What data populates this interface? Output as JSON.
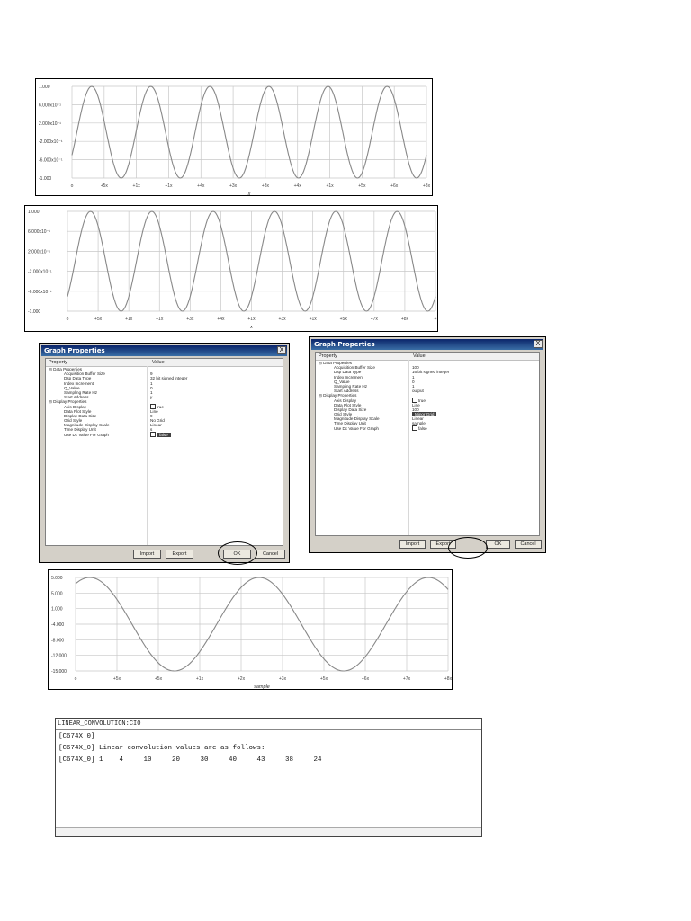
{
  "chart_data": [
    {
      "type": "line",
      "title": "",
      "xlabel": "x",
      "ylabel": "",
      "y_ticks": [
        "1.000",
        "6.000x10⁻¹",
        "2.000x10⁻¹",
        "-2.000x10⁻¹",
        "-6.000x10⁻¹",
        "-1.000"
      ],
      "x_ticks": [
        "o",
        "+5x",
        "+1x",
        "+1x",
        "+4x",
        "+3x",
        "+3x",
        "+4x",
        "+1x",
        "+5x",
        "+6x",
        "+8x"
      ],
      "ylim": [
        -1,
        1
      ],
      "xlim": [
        0,
        12
      ],
      "grid": true,
      "series": [
        {
          "x_start": 0,
          "x_end": 12,
          "cycles": 6,
          "amplitude": 1,
          "phase_deg": -30,
          "color": "#888888"
        }
      ]
    },
    {
      "type": "line",
      "title": "",
      "xlabel": "x",
      "ylabel": "",
      "y_ticks": [
        "1.000",
        "6.000x10⁻¹",
        "2.000x10⁻¹",
        "-2.000x10⁻¹",
        "-6.000x10⁻¹",
        "-1.000"
      ],
      "x_ticks": [
        "o",
        "+5x",
        "+1x",
        "+1x",
        "+3x",
        "+4x",
        "+1x",
        "+3x",
        "+1x",
        "+5x",
        "+7x",
        "+8x",
        "+"
      ],
      "ylim": [
        -1,
        1
      ],
      "xlim": [
        0,
        12
      ],
      "grid": true,
      "series": [
        {
          "x_start": 0,
          "x_end": 12,
          "cycles": 6,
          "amplitude": 1,
          "phase_deg": -45,
          "color": "#888888"
        }
      ]
    },
    {
      "type": "line",
      "title": "",
      "xlabel": "sample",
      "ylabel": "",
      "y_ticks": [
        "5.000",
        "5.000",
        "1.000",
        "-4.000",
        "-8.000",
        "-12.000",
        "-15.000"
      ],
      "x_ticks": [
        "o",
        "+5x",
        "+5x",
        "+1x",
        "+2x",
        "+3x",
        "+5x",
        "+6x",
        "+7x",
        "+8x"
      ],
      "ylim": [
        -1,
        1
      ],
      "xlim": [
        0,
        9
      ],
      "grid": true,
      "series": [
        {
          "x_start": 0,
          "x_end": 9,
          "cycles": 2.2,
          "amplitude": 1,
          "phase_deg": 60,
          "color": "#888888"
        }
      ]
    }
  ],
  "dialog_left": {
    "title": "Graph Properties",
    "close": "X",
    "header": {
      "property": "Property",
      "value": "Value"
    },
    "rows": [
      {
        "p": "⊟ Data Properties",
        "v": "",
        "indent": 0
      },
      {
        "p": "Acquisition Buffer Size",
        "v": "9",
        "indent": 1
      },
      {
        "p": "Dsp Data Type",
        "v": "32 bit signed integer",
        "indent": 1
      },
      {
        "p": "Index Increment",
        "v": "1",
        "indent": 1
      },
      {
        "p": "Q_Value",
        "v": "0",
        "indent": 1
      },
      {
        "p": "Sampling Rate Hz",
        "v": "1",
        "indent": 1
      },
      {
        "p": "Start Address",
        "v": "y",
        "indent": 1
      },
      {
        "p": "⊟ Display Properties",
        "v": "",
        "indent": 0
      },
      {
        "p": "Axis Display",
        "v": "true",
        "indent": 1,
        "check": true
      },
      {
        "p": "Data Plot Style",
        "v": "Line",
        "indent": 1
      },
      {
        "p": "Display Data Size",
        "v": "9",
        "indent": 1
      },
      {
        "p": "Grid Style",
        "v": "No Grid",
        "indent": 1
      },
      {
        "p": "Magnitude Display Scale",
        "v": "Linear",
        "indent": 1
      },
      {
        "p": "Time Display Unit",
        "v": "s",
        "indent": 1
      },
      {
        "p": "Use Dc Value For Graph",
        "v": "false",
        "indent": 1,
        "check": true,
        "selected": true
      }
    ],
    "buttons": {
      "import": "Import",
      "export": "Export",
      "ok": "OK",
      "cancel": "Cancel"
    }
  },
  "dialog_right": {
    "title": "Graph Properties",
    "close": "X",
    "header": {
      "property": "Property",
      "value": "Value"
    },
    "rows": [
      {
        "p": "⊟ Data Properties",
        "v": "",
        "indent": 0
      },
      {
        "p": "Acquisition Buffer Size",
        "v": "100",
        "indent": 1
      },
      {
        "p": "Dsp Data Type",
        "v": "16 bit signed integer",
        "indent": 1
      },
      {
        "p": "Index Increment",
        "v": "1",
        "indent": 1
      },
      {
        "p": "Q_Value",
        "v": "0",
        "indent": 1
      },
      {
        "p": "Sampling Rate Hz",
        "v": "1",
        "indent": 1
      },
      {
        "p": "Start Address",
        "v": "output",
        "indent": 1
      },
      {
        "p": "⊟ Display Properties",
        "v": "",
        "indent": 0
      },
      {
        "p": "Axis Display",
        "v": "true",
        "indent": 1,
        "check": true
      },
      {
        "p": "Data Plot Style",
        "v": "Line",
        "indent": 1
      },
      {
        "p": "Display Data Size",
        "v": "100",
        "indent": 1
      },
      {
        "p": "Grid Style",
        "v": "Minor Grid",
        "indent": 1,
        "selected": true
      },
      {
        "p": "Magnitude Display Scale",
        "v": "Linear",
        "indent": 1
      },
      {
        "p": "Time Display Unit",
        "v": "sample",
        "indent": 1
      },
      {
        "p": "Use Dc Value For Graph",
        "v": "false",
        "indent": 1,
        "check": true
      }
    ],
    "buttons": {
      "import": "Import",
      "export": "Export",
      "ok": "OK",
      "cancel": "Cancel"
    }
  },
  "console": {
    "title": "LINEAR_CONVOLUTION:CIO",
    "lines": [
      "[C674X_0]",
      "[C674X_0] Linear convolution values are as follows:",
      "[C674X_0] 1    4     10     20     30     40     43     38     24"
    ]
  }
}
